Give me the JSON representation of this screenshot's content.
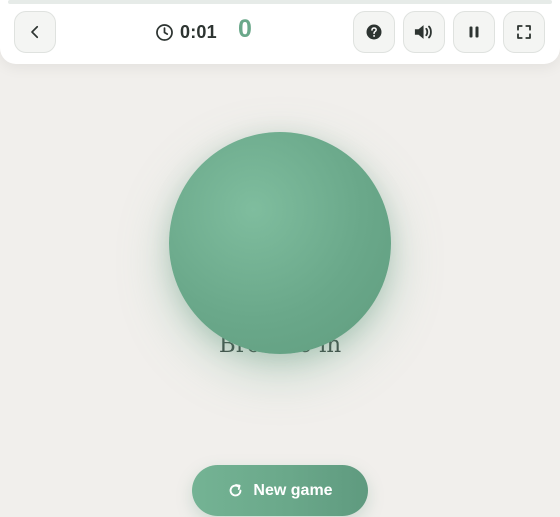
{
  "header": {
    "progress_fraction": 0.0,
    "timer": "0:01",
    "score": "0"
  },
  "breathing": {
    "instruction": "Breathe in"
  },
  "actions": {
    "new_game_label": "New game"
  },
  "icons": {
    "back": "chevron-left-icon",
    "timer": "clock-icon",
    "help": "question-circle-icon",
    "sound": "speaker-icon",
    "pause": "pause-icon",
    "fullscreen": "fullscreen-icon",
    "restart": "refresh-icon"
  },
  "colors": {
    "accent": "#6aa88a",
    "background": "#f1efec",
    "text": "#2d3431"
  }
}
